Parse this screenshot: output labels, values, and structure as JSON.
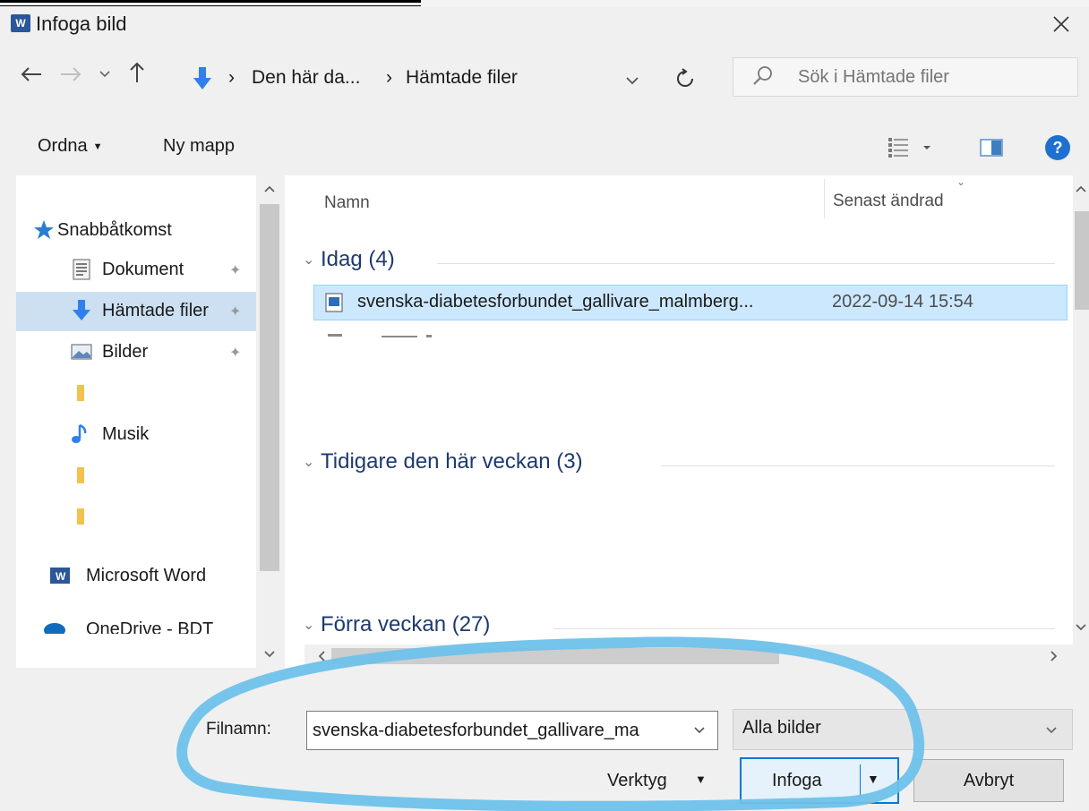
{
  "window": {
    "app_icon_letter": "W",
    "title": "Infoga bild",
    "close_glyph": "✕"
  },
  "address": {
    "crumbs": [
      "Den här da...",
      "Hämtade filer"
    ],
    "separator": "›",
    "dropdown_glyph": "⌄",
    "refresh_glyph": "↻"
  },
  "search": {
    "placeholder": "Sök i Hämtade filer"
  },
  "toolbar": {
    "organize_label": "Ordna",
    "new_folder_label": "Ny mapp"
  },
  "nav_pane": {
    "items": [
      {
        "label": "Snabbåtkomst",
        "icon": "star-icon",
        "pinned": false
      },
      {
        "label": "Dokument",
        "icon": "document-icon",
        "pinned": true
      },
      {
        "label": "Hämtade filer",
        "icon": "download-arrow-icon",
        "pinned": true,
        "selected": true
      },
      {
        "label": "Bilder",
        "icon": "pictures-icon",
        "pinned": true
      },
      {
        "label": "",
        "icon": "folder-icon",
        "pinned": false
      },
      {
        "label": "Musik",
        "icon": "music-note-icon",
        "pinned": false
      },
      {
        "label": "",
        "icon": "folder-icon",
        "pinned": false
      },
      {
        "label": "",
        "icon": "folder-icon",
        "pinned": false
      },
      {
        "label": "Microsoft Word",
        "icon": "word-icon",
        "pinned": false
      },
      {
        "label": "OneDrive - BDT",
        "icon": "onedrive-cloud-icon",
        "pinned": false
      }
    ]
  },
  "file_list": {
    "columns": {
      "name": "Namn",
      "modified": "Senast ändrad"
    },
    "groups": [
      {
        "title": "Idag (4)"
      },
      {
        "title": "Tidigare den här veckan (3)"
      },
      {
        "title": "Förra veckan (27)"
      }
    ],
    "selected_file": {
      "name": "svenska-diabetesforbundet_gallivare_malmberg...",
      "modified": "2022-09-14 15:54"
    }
  },
  "bottom": {
    "filename_label": "Filnamn:",
    "filename_value": "svenska-diabetesforbundet_gallivare_ma",
    "filetype_value": "Alla bilder",
    "tools_label": "Verktyg",
    "insert_label": "Infoga",
    "cancel_label": "Avbryt"
  },
  "colors": {
    "accent": "#0078d7",
    "selection": "#cce8ff",
    "nav_selection": "#cce0f2",
    "annotation_ring": "#6ec1ea"
  }
}
